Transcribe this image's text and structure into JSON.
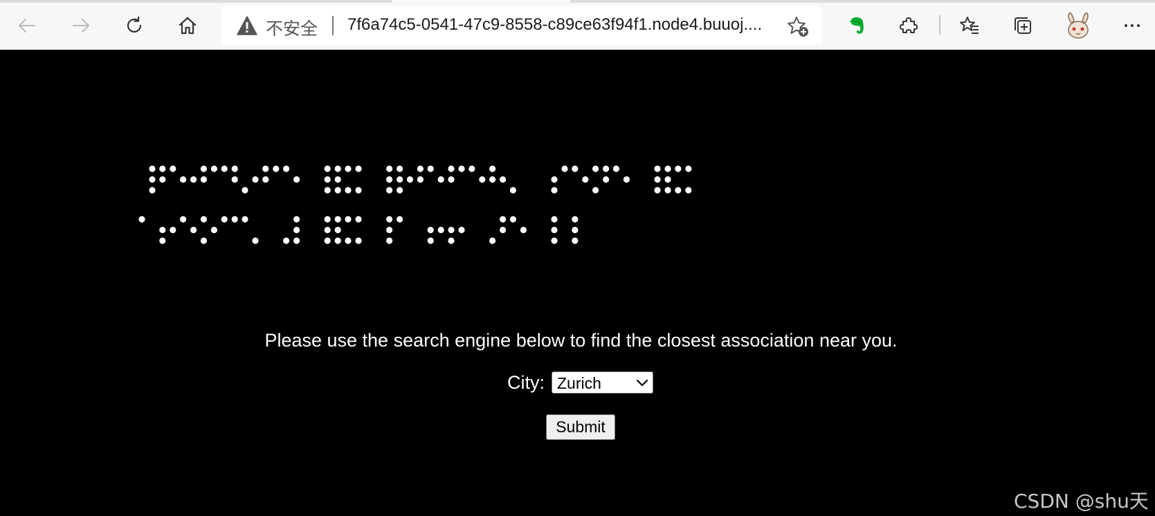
{
  "browser": {
    "address_bar": {
      "security_text": "不安全",
      "url": "7f6a74c5-0541-47c9-8558-c89ce63f94f1.node4.buuoj...."
    },
    "icons": {
      "back": "arrow-left-icon",
      "forward": "arrow-right-icon",
      "refresh": "refresh-icon",
      "home": "home-icon",
      "insecure": "warning-icon",
      "add_favorite": "star-plus-icon",
      "evernote": "evernote-icon",
      "extensions": "puzzle-icon",
      "favorites": "favorites-icon",
      "collections": "collections-icon",
      "profile": "rabbit-avatar-icon",
      "menu": "more-icon"
    }
  },
  "page": {
    "braille": {
      "rows": [
        [
          [
            4,
            5,
            6
          ],
          [
            1,
            2,
            4
          ],
          [
            2,
            5
          ],
          [
            1,
            2,
            4
          ],
          [
            1,
            4,
            5
          ],
          [
            3,
            5
          ],
          [
            1,
            2,
            4
          ],
          [
            1,
            5
          ],
          [],
          [
            1,
            2,
            3,
            4,
            5,
            6
          ],
          [
            1,
            3,
            4,
            6
          ],
          [],
          [
            1,
            2,
            3,
            4,
            5,
            6
          ],
          [
            2,
            4,
            5
          ],
          [
            1,
            5
          ],
          [
            1,
            2,
            4
          ],
          [
            1,
            5
          ],
          [
            1,
            2,
            5
          ],
          [
            3
          ],
          [],
          [
            2,
            3,
            4
          ],
          [
            1,
            5
          ],
          [
            1,
            3,
            4,
            5
          ],
          [
            1,
            5
          ],
          [],
          [
            1,
            2,
            3,
            4,
            5,
            6
          ],
          [
            1,
            3,
            4,
            6
          ]
        ],
        [
          [
            1
          ],
          [
            2,
            3,
            5
          ],
          [
            1,
            5
          ],
          [
            1,
            3,
            5
          ],
          [
            1,
            4
          ],
          [
            1,
            6
          ],
          [],
          [
            3,
            4,
            5,
            6
          ],
          [],
          [
            1,
            2,
            3,
            4,
            5,
            6
          ],
          [
            1,
            3,
            4,
            6
          ],
          [],
          [
            1,
            2,
            3,
            4
          ],
          [],
          [
            2,
            3,
            5
          ],
          [
            2,
            3,
            5
          ],
          [],
          [
            3,
            4,
            5
          ],
          [
            1,
            5
          ],
          [],
          [
            1,
            2,
            3
          ],
          [
            1,
            2,
            3
          ]
        ]
      ]
    },
    "prompt": "Please use the search engine below to find the closest association near you.",
    "city_label": "City:",
    "city_selected": "Zurich",
    "submit_label": "Submit"
  },
  "watermark": "CSDN @shu天",
  "colors": {
    "page_background": "#000000",
    "text": "#ffffff",
    "braille_dot": "#ffffff",
    "chrome_background": "#f7f7f7",
    "evernote_green": "#00a82d"
  }
}
